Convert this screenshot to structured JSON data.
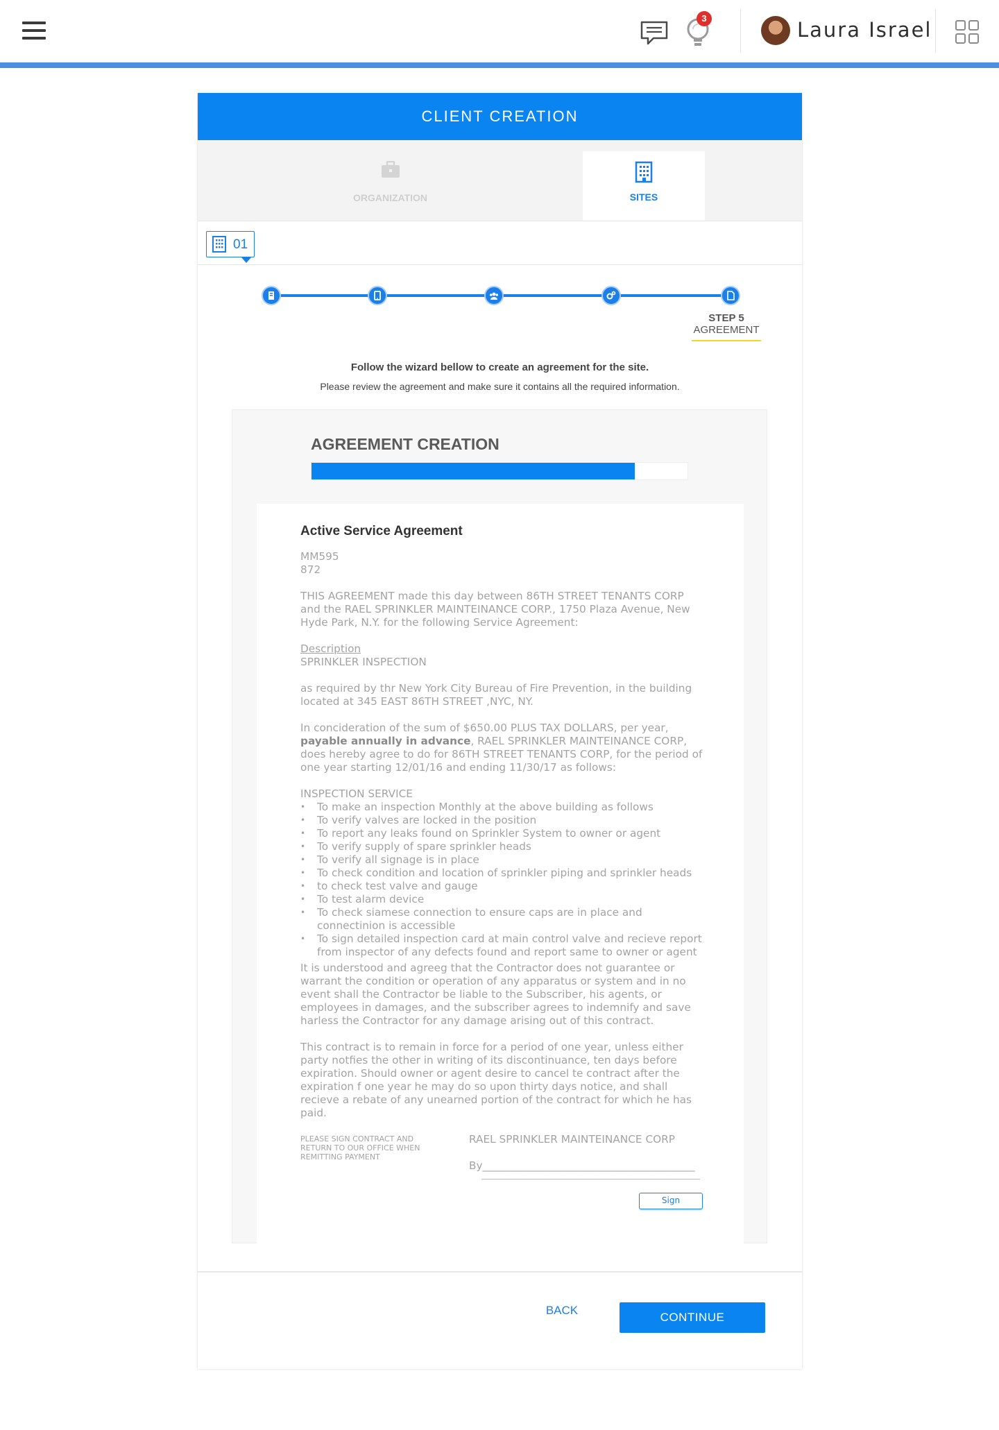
{
  "topbar": {
    "menu_icon": "hamburger-menu-icon",
    "chat_icon": "chat-icon",
    "notification_icon": "lightbulb-icon",
    "notification_count": "3",
    "user_name": "Laura Israel",
    "apps_icon": "apps-grid-icon"
  },
  "card": {
    "title": "CLIENT CREATION",
    "tabs": [
      {
        "label": "ORGANIZATION",
        "icon": "briefcase-icon"
      },
      {
        "label": "SITES",
        "icon": "building-icon"
      }
    ],
    "site_number": "01",
    "step_label": "STEP 5",
    "step_name": "AGREEMENT",
    "instruction_main": "Follow the wizard bellow to create an agreement for the site.",
    "instruction_sub": "Please review the agreement and make sure it contains all the required information."
  },
  "agreement": {
    "heading": "AGREEMENT CREATION",
    "progress": 0.86,
    "doc_title": "Active Service Agreement",
    "code_line1": "MM595",
    "code_line2": "872",
    "intro": "THIS AGREEMENT made this day between 86TH STREET TENANTS CORP and the RAEL SPRINKLER MAINTEINANCE CORP., 1750 Plaza Avenue, New Hyde Park, N.Y. for the following Service Agreement:",
    "description_label": "Description",
    "description_value": "SPRINKLER INSPECTION",
    "required_text": "as required by thr New York City Bureau of  Fire Prevention, in the building located at 345 EAST 86TH STREET ,NYC, NY.",
    "consideration_a": "In concideration of the sum of $650.00 PLUS TAX DOLLARS, per year,",
    "consideration_bold": "payable annually in advance",
    "consideration_b": ", RAEL SPRINKLER MAINTEINANCE CORP, does hereby agree to do for 86TH STREET TENANTS CORP,  for the period of one year starting 12/01/16 and ending 11/30/17 as follows:",
    "service_heading": "INSPECTION SERVICE",
    "service_items": [
      "To make an inspection Monthly at the above building as follows",
      "To verify valves are locked in the position",
      "To report any leaks found on Sprinkler System to owner or agent",
      "To verify supply of spare sprinkler heads",
      "To verify all signage is in place",
      "To check condition and location of sprinkler piping and sprinkler heads",
      "to check test valve and gauge",
      "To test alarm device",
      "To check siamese connection to ensure caps are in place and connectinion is accessible",
      "To sign detailed inspection card at main control valve and recieve report from inspector of any defects found and report same to owner or agent"
    ],
    "liability": "It is understood and agreeg that the Contractor does not guarantee or warrant the condition or operation of any apparatus or system and in no event shall the Contractor be liable to the Subscriber, his agents, or employees in damages, and the subscriber agrees to indemnify and save harless the Contractor for any damage arising out of this contract.",
    "term": "This contract is to remain in force for a period of one year, unless either party notfies the other in writing of its discontinuance, ten days before expiration. Should owner or agent desire to cancel te contract after the expiration f one year he may do so upon thirty days notice, and shall recieve a rebate of any unearned portion of the contract for which he has paid.",
    "sign_note": "PLEASE SIGN CONTRACT AND RETURN TO OUR OFFICE WHEN REMITTING PAYMENT",
    "company": "RAEL SPRINKLER MAINTEINANCE CORP",
    "by_line": "By________________________________________",
    "sign_button": "Sign"
  },
  "footer": {
    "back_label": "BACK",
    "continue_label": "CONTINUE"
  },
  "colors": {
    "primary": "#0a84f0",
    "accent_line": "#4a8fe0",
    "badge": "#e0302c",
    "step_underline": "#f5d327"
  }
}
